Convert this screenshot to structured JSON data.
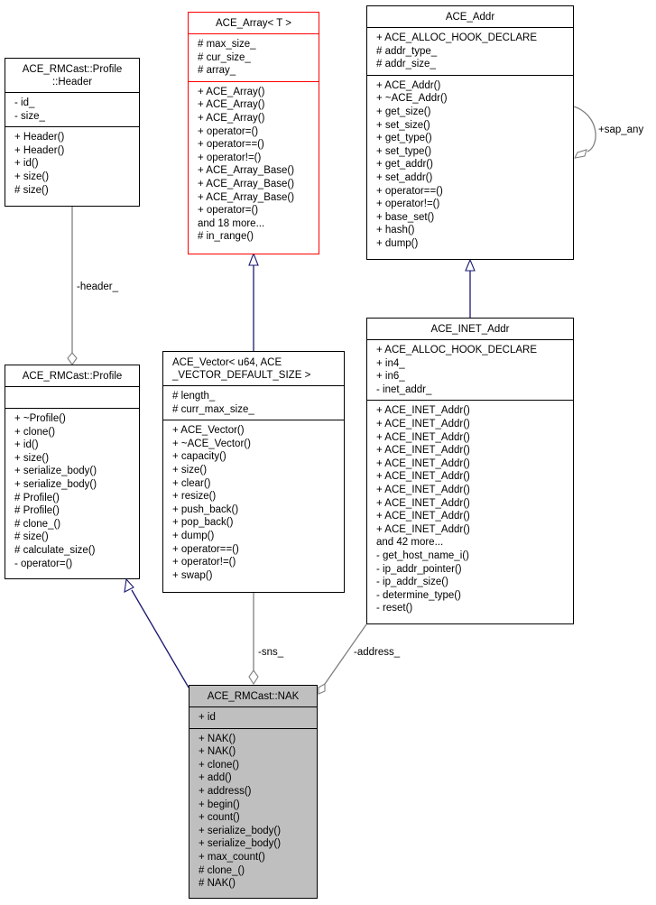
{
  "classes": {
    "header": {
      "title_lines": [
        "ACE_RMCast::Profile",
        "::Header"
      ],
      "attributes": [
        "- id_",
        "- size_"
      ],
      "operations": [
        "+ Header()",
        "+ Header()",
        "+ id()",
        "+ size()",
        "# size()"
      ]
    },
    "array": {
      "title": "ACE_Array< T >",
      "attributes": [
        "# max_size_",
        "# cur_size_",
        "# array_"
      ],
      "operations": [
        "+ ACE_Array()",
        "+ ACE_Array()",
        "+ ACE_Array()",
        "+ operator=()",
        "+ operator==()",
        "+ operator!=()",
        "+ ACE_Array_Base()",
        "+ ACE_Array_Base()",
        "+ ACE_Array_Base()",
        "+ operator=()",
        "and 18 more...",
        "# in_range()"
      ]
    },
    "addr": {
      "title": "ACE_Addr",
      "attributes": [
        "+ ACE_ALLOC_HOOK_DECLARE",
        "# addr_type_",
        "# addr_size_"
      ],
      "operations": [
        "+ ACE_Addr()",
        "+ ~ACE_Addr()",
        "+ get_size()",
        "+ set_size()",
        "+ get_type()",
        "+ set_type()",
        "+ get_addr()",
        "+ set_addr()",
        "+ operator==()",
        "+ operator!=()",
        "+ base_set()",
        "+ hash()",
        "+ dump()"
      ]
    },
    "profile": {
      "title": "ACE_RMCast::Profile",
      "attributes": [],
      "operations": [
        "+ ~Profile()",
        "+ clone()",
        "+ id()",
        "+ size()",
        "+ serialize_body()",
        "+ serialize_body()",
        "# Profile()",
        "# Profile()",
        "# clone_()",
        "# size()",
        "# calculate_size()",
        "- operator=()"
      ]
    },
    "vector": {
      "title_lines": [
        "ACE_Vector< u64, ACE",
        "_VECTOR_DEFAULT_SIZE >"
      ],
      "attributes": [
        "# length_",
        "# curr_max_size_"
      ],
      "operations": [
        "+ ACE_Vector()",
        "+ ~ACE_Vector()",
        "+ capacity()",
        "+ size()",
        "+ clear()",
        "+ resize()",
        "+ push_back()",
        "+ pop_back()",
        "+ dump()",
        "+ operator==()",
        "+ operator!=()",
        "+ swap()"
      ]
    },
    "inet": {
      "title": "ACE_INET_Addr",
      "attributes": [
        "+ ACE_ALLOC_HOOK_DECLARE",
        "+ in4_",
        "+ in6_",
        "- inet_addr_"
      ],
      "operations": [
        "+ ACE_INET_Addr()",
        "+ ACE_INET_Addr()",
        "+ ACE_INET_Addr()",
        "+ ACE_INET_Addr()",
        "+ ACE_INET_Addr()",
        "+ ACE_INET_Addr()",
        "+ ACE_INET_Addr()",
        "+ ACE_INET_Addr()",
        "+ ACE_INET_Addr()",
        "+ ACE_INET_Addr()",
        "and 42 more...",
        "- get_host_name_i()",
        "- ip_addr_pointer()",
        "- ip_addr_size()",
        "- determine_type()",
        "- reset()"
      ]
    },
    "nak": {
      "title": "ACE_RMCast::NAK",
      "attributes": [
        "+ id"
      ],
      "operations": [
        "+ NAK()",
        "+ NAK()",
        "+ clone()",
        "+ add()",
        "+ address()",
        "+ begin()",
        "+ count()",
        "+ serialize_body()",
        "+ serialize_body()",
        "+ max_count()",
        "# clone_()",
        "# NAK()"
      ]
    }
  },
  "edge_labels": {
    "header": "-header_",
    "sap_any": "+sap_any",
    "sns": "-sns_",
    "address": "-address_"
  },
  "colors": {
    "inheritance": "#191970",
    "association": "#808080",
    "template_border": "#ff0000",
    "focus_fill": "#bfbfbf"
  }
}
